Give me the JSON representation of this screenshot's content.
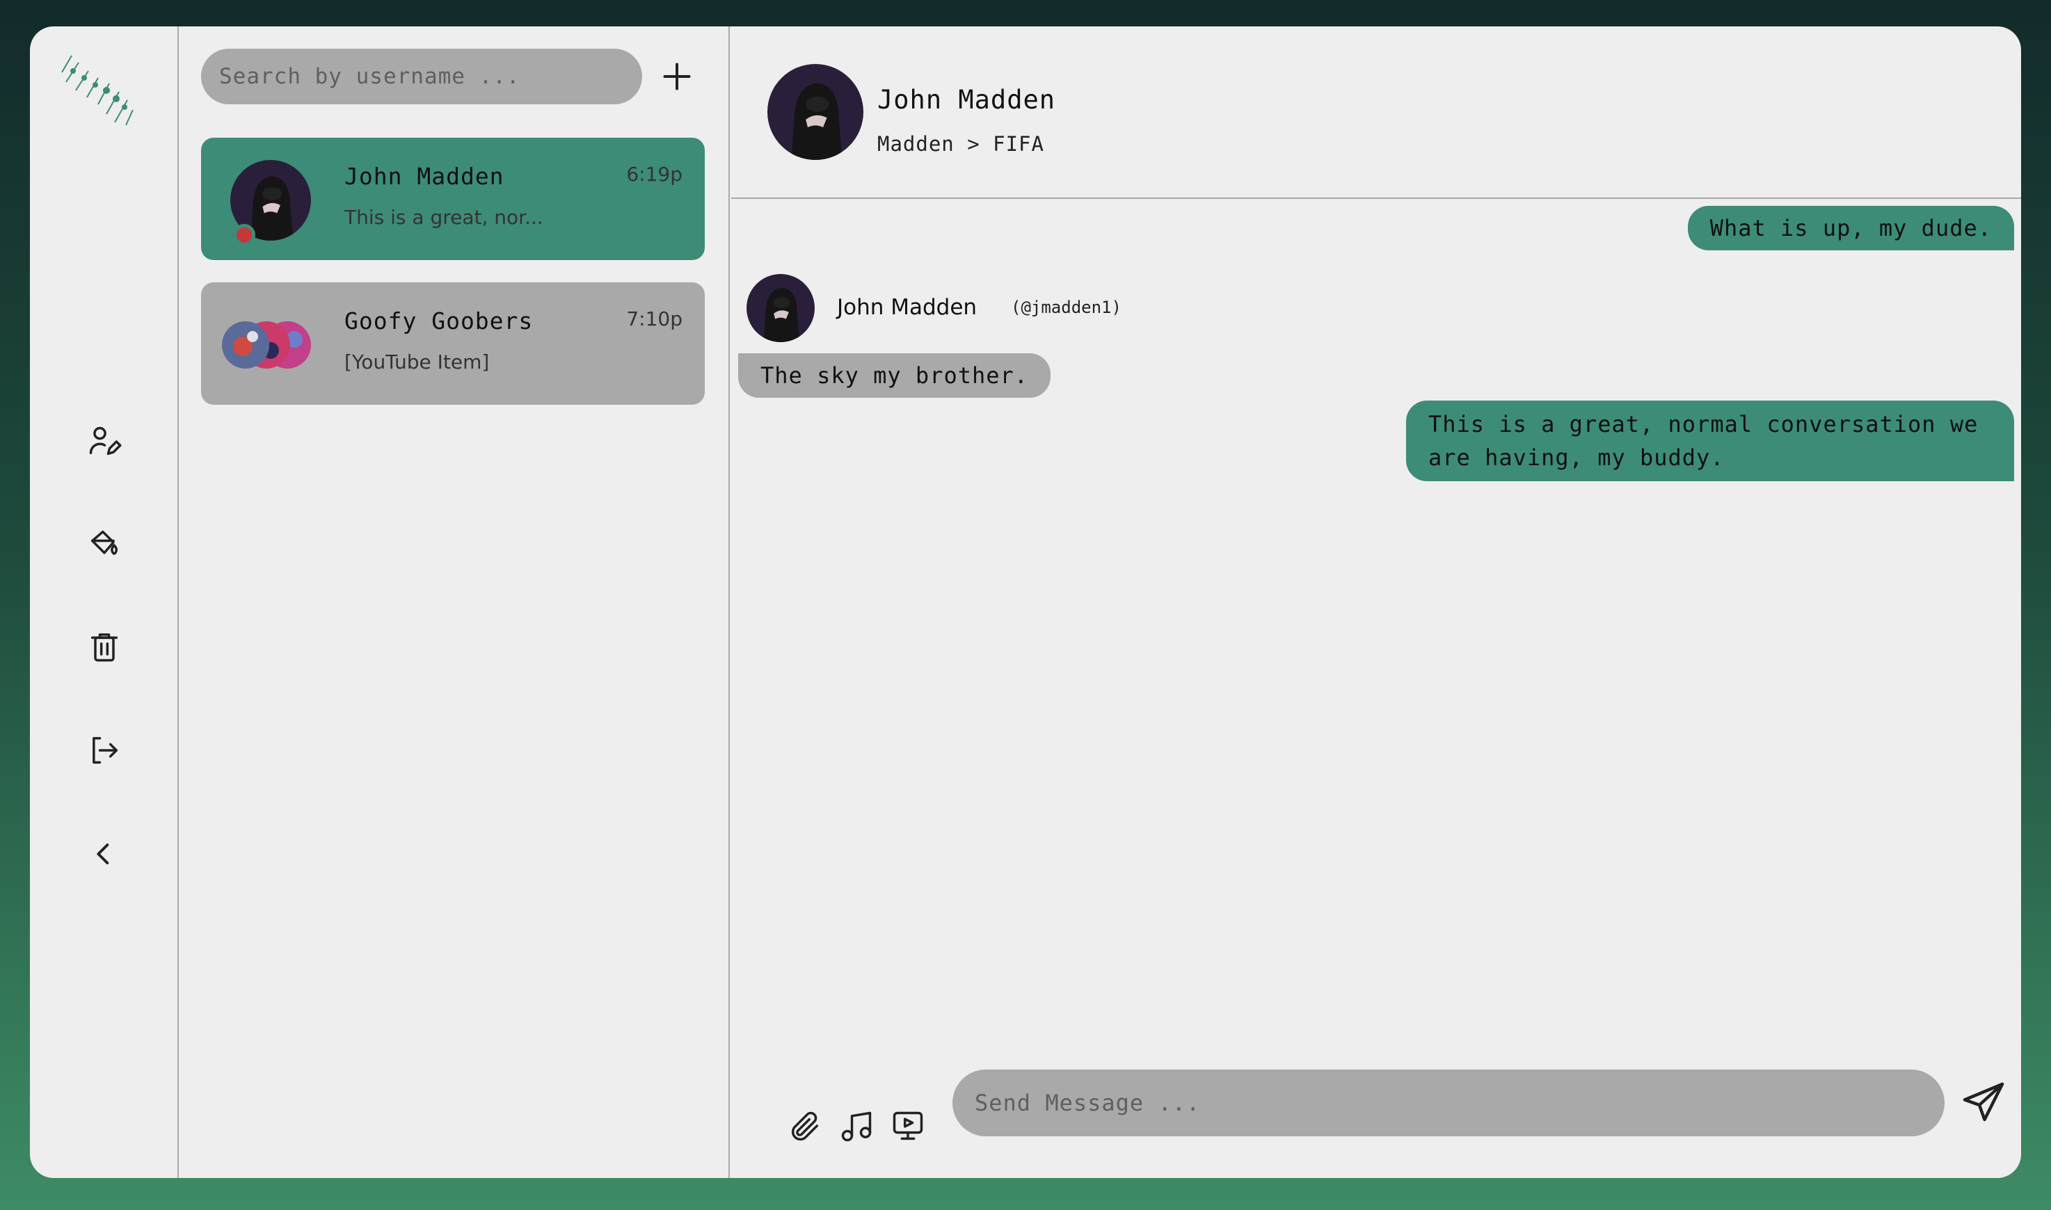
{
  "sidebar": {
    "icons": [
      "user-edit-icon",
      "paint-bucket-icon",
      "trash-icon",
      "logout-icon",
      "chevron-left-icon"
    ]
  },
  "conversations": {
    "search_placeholder": "Search by username ...",
    "items": [
      {
        "name": "John Madden",
        "preview": "This is a great, nor...",
        "time": "6:19p",
        "active": true
      },
      {
        "name": "Goofy Goobers",
        "preview": "[YouTube Item]",
        "time": "7:10p",
        "active": false
      }
    ]
  },
  "chat": {
    "header": {
      "name": "John Madden",
      "status": "Madden > FIFA"
    },
    "messages": [
      {
        "direction": "out",
        "text": "What is up, my dude."
      },
      {
        "direction": "in",
        "sender": "John Madden",
        "handle": "(@jmadden1)",
        "text": "The sky my brother."
      },
      {
        "direction": "out",
        "text": "This is a great, normal conversation we are having, my buddy."
      }
    ],
    "composer": {
      "placeholder": "Send Message ..."
    }
  },
  "colors": {
    "accent": "#3d8c77",
    "panel": "#eeeeee",
    "bubble_in": "#a9a9a9",
    "status_dot": "#c4383a"
  }
}
